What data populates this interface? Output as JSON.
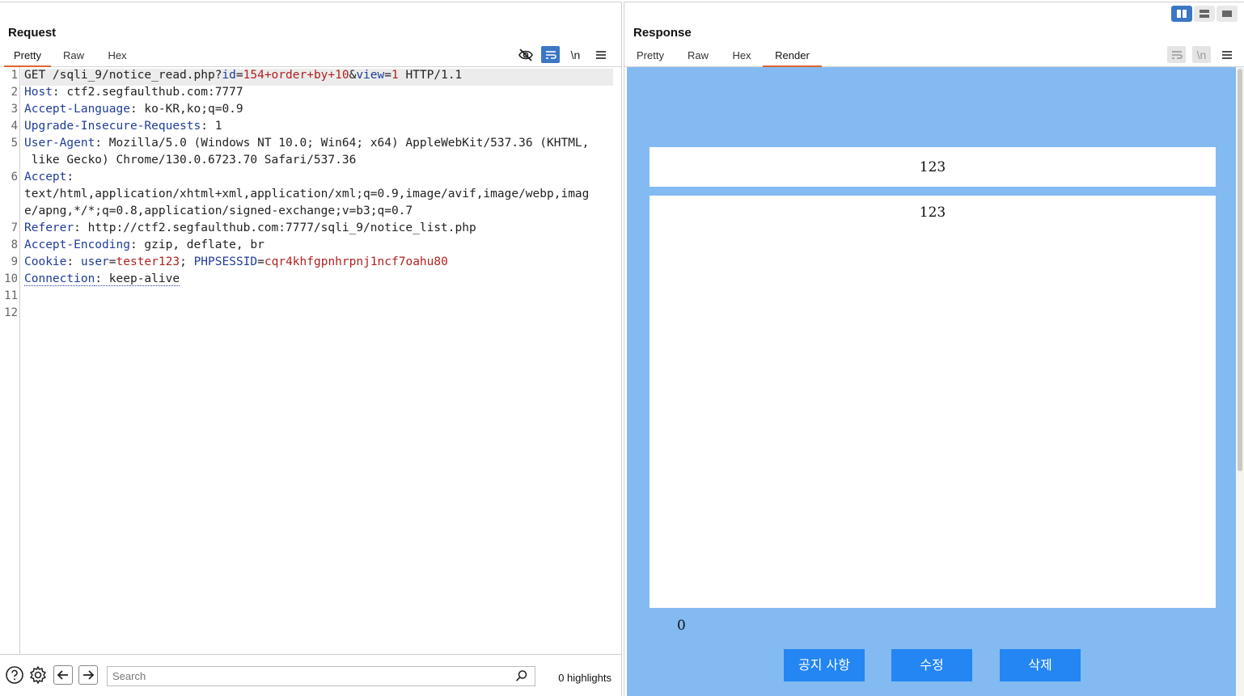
{
  "request": {
    "title": "Request",
    "tabs": [
      "Pretty",
      "Raw",
      "Hex"
    ],
    "active_tab": "Pretty",
    "toolbar_icons": [
      "eye-slash-icon",
      "word-wrap-icon",
      "newline-icon",
      "menu-icon"
    ],
    "newline_label": "\\n",
    "lines": [
      {
        "n": "1",
        "parts": [
          [
            "t",
            "GET /sqli_9/notice_read.php?"
          ],
          [
            "h",
            "id"
          ],
          [
            "t",
            "="
          ],
          [
            "v",
            "154+order+by+10"
          ],
          [
            "t",
            "&"
          ],
          [
            "h",
            "view"
          ],
          [
            "t",
            "="
          ],
          [
            "v",
            "1"
          ],
          [
            "t",
            " HTTP/1.1"
          ]
        ]
      },
      {
        "n": "2",
        "parts": [
          [
            "h",
            "Host"
          ],
          [
            "t",
            ": ctf2.segfaulthub.com:7777"
          ]
        ]
      },
      {
        "n": "3",
        "parts": [
          [
            "h",
            "Accept-Language"
          ],
          [
            "t",
            ": ko-KR,ko;q=0.9"
          ]
        ]
      },
      {
        "n": "4",
        "parts": [
          [
            "h",
            "Upgrade-Insecure-Requests"
          ],
          [
            "t",
            ": 1"
          ]
        ]
      },
      {
        "n": "5",
        "parts": [
          [
            "h",
            "User-Agent"
          ],
          [
            "t",
            ": Mozilla/5.0 (Windows NT 10.0; Win64; x64) AppleWebKit/537.36 (KHTML,"
          ]
        ]
      },
      {
        "n": "",
        "parts": [
          [
            "t",
            " like Gecko) Chrome/130.0.6723.70 Safari/537.36"
          ]
        ]
      },
      {
        "n": "6",
        "parts": [
          [
            "h",
            "Accept"
          ],
          [
            "t",
            ":"
          ]
        ]
      },
      {
        "n": "",
        "parts": [
          [
            "t",
            "text/html,application/xhtml+xml,application/xml;q=0.9,image/avif,image/webp,imag"
          ]
        ]
      },
      {
        "n": "",
        "parts": [
          [
            "t",
            "e/apng,*/*;q=0.8,application/signed-exchange;v=b3;q=0.7"
          ]
        ]
      },
      {
        "n": "7",
        "parts": [
          [
            "h",
            "Referer"
          ],
          [
            "t",
            ": http://ctf2.segfaulthub.com:7777/sqli_9/notice_list.php"
          ]
        ]
      },
      {
        "n": "8",
        "parts": [
          [
            "h",
            "Accept-Encoding"
          ],
          [
            "t",
            ": gzip, deflate, br"
          ]
        ]
      },
      {
        "n": "9",
        "parts": [
          [
            "h",
            "Cookie"
          ],
          [
            "t",
            ": "
          ],
          [
            "h",
            "user"
          ],
          [
            "t",
            "="
          ],
          [
            "v",
            "tester123"
          ],
          [
            "t",
            "; "
          ],
          [
            "h",
            "PHPSESSID"
          ],
          [
            "t",
            "="
          ],
          [
            "v",
            "cqr4khfgpnhrpnj1ncf7oahu80"
          ]
        ]
      },
      {
        "n": "10",
        "parts": [
          [
            "hd",
            "Connection"
          ],
          [
            "td",
            ": keep-alive"
          ]
        ]
      },
      {
        "n": "11",
        "parts": []
      },
      {
        "n": "12",
        "parts": []
      }
    ],
    "search": {
      "placeholder": "Search",
      "highlights": "0 highlights"
    }
  },
  "response": {
    "title": "Response",
    "tabs": [
      "Pretty",
      "Raw",
      "Hex",
      "Render"
    ],
    "active_tab": "Render",
    "newline_label": "\\n",
    "render": {
      "post_title": "123",
      "post_content": "123",
      "views": "0",
      "buttons": [
        "공지 사항",
        "수정",
        "삭제"
      ]
    }
  },
  "colors": {
    "accent_tab": "#e0652e",
    "header_name": "#1f3c99",
    "param_value": "#b21f1f",
    "render_bg": "#84baf2",
    "render_button": "#2386f2",
    "toggle_active": "#3b77c4"
  }
}
